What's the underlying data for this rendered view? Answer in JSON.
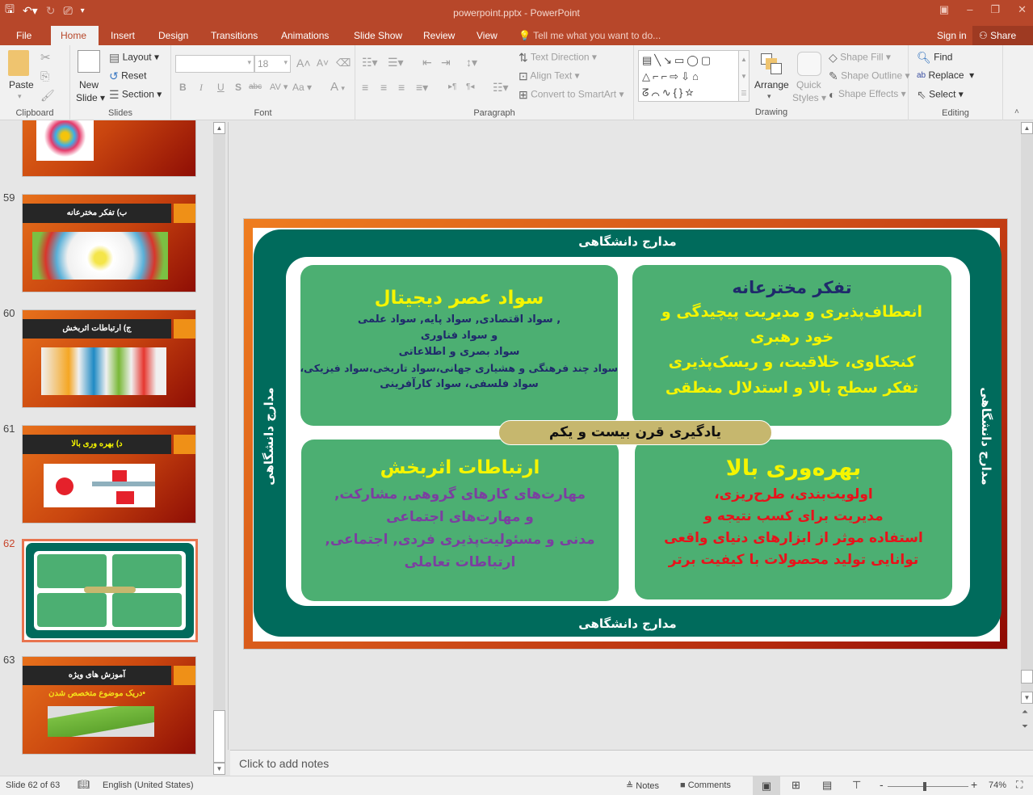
{
  "app": {
    "title": "powerpoint.pptx - PowerPoint",
    "qat": {
      "save_icon": "save-icon",
      "undo_icon": "undo-icon",
      "redo_icon": "redo-icon",
      "present_icon": "present-from-start-icon",
      "customize_icon": "customize-qat-icon"
    },
    "window_controls": {
      "ribbon_options": "▣",
      "minimize": "–",
      "restore": "❐",
      "close": "✕"
    }
  },
  "tabs": [
    {
      "label": "File"
    },
    {
      "label": "Home",
      "active": true
    },
    {
      "label": "Insert"
    },
    {
      "label": "Design"
    },
    {
      "label": "Transitions"
    },
    {
      "label": "Animations"
    },
    {
      "label": "Slide Show"
    },
    {
      "label": "Review"
    },
    {
      "label": "View"
    }
  ],
  "tell_me": "Tell me what you want to do...",
  "sign_in": "Sign in",
  "share": "Share",
  "ribbon": {
    "clipboard": {
      "label": "Clipboard",
      "paste": "Paste"
    },
    "slides": {
      "label": "Slides",
      "new_slide": "New",
      "new_slide_2": "Slide",
      "layout": "Layout",
      "reset": "Reset",
      "section": "Section"
    },
    "font": {
      "label": "Font",
      "font_name": "",
      "font_size": "18",
      "bold": "B",
      "italic": "I",
      "underline": "U",
      "shadow": "S",
      "strike": "abc",
      "spacing": "AV",
      "case": "Aa",
      "color": "A"
    },
    "paragraph": {
      "label": "Paragraph",
      "text_direction": "Text Direction",
      "align_text": "Align Text",
      "convert_smartart": "Convert to SmartArt"
    },
    "drawing": {
      "label": "Drawing",
      "shapes_row1": "▤╲↘▭◯▢",
      "shapes_row2": "△⌐⌐⇨⇩⌂",
      "shapes_row3": "ᘔ⌒∿{}☆",
      "arrange": "Arrange",
      "quick_styles_1": "Quick",
      "quick_styles_2": "Styles",
      "shape_fill": "Shape Fill",
      "shape_outline": "Shape Outline",
      "shape_effects": "Shape Effects"
    },
    "editing": {
      "label": "Editing",
      "find": "Find",
      "replace": "Replace",
      "select": "Select"
    }
  },
  "thumbnails": [
    {
      "number": "",
      "title": ""
    },
    {
      "number": "59",
      "title": "ب) تفکر مخترعانه"
    },
    {
      "number": "60",
      "title": "ج) ارتباطات اثربخش"
    },
    {
      "number": "61",
      "title": "د) بهره وری بالا"
    },
    {
      "number": "62",
      "title": "",
      "selected": true
    },
    {
      "number": "63",
      "title": "آموزش های ویژه",
      "subtitle": "•دریک موضوع متخصص شدن"
    }
  ],
  "slide": {
    "edge_top": "مدارج دانشگاهی",
    "edge_bottom": "مدارج دانشگاهی",
    "edge_left": "مدارج دانشگاهی",
    "edge_right": "مدارج دانشگاهی",
    "center_pill": "یادگیری قرن بیست و یکم",
    "cards": {
      "top_left": {
        "title": "سواد عصر دیجیتال",
        "lines": [
          ", سواد اقتصادی,  سواد پایه, سواد علمی",
          "و سواد فناوری",
          "سواد بصری و اطلاعاتی",
          "سواد چند فرهنگی و هشیاری جهانی،سواد تاریخی،سواد فیزیکی،",
          "سواد فلسفی، سواد کارآفرینی"
        ],
        "title_color": "#f5f500",
        "text_color": "#1f2a6b"
      },
      "top_right": {
        "title": "تفکر مخترعانه",
        "lines": [
          "انعطاف‌پذیری و مدیریت پیچیدگی و",
          "خود رهبری",
          "کنجکاوی، خلاقیت، و ریسک‌پذیری",
          "تفکر سطح بالا و استدلال منطقی"
        ],
        "title_color": "#1f2a6b",
        "text_color": "#f5f500"
      },
      "bottom_left": {
        "title": "ارتباطات اثربخش",
        "lines": [
          "مهارت‌های کارهای گروهی, مشارکت,",
          "و مهارت‌های اجتماعی",
          "مدنی و مسئولیت‌پذیری فردی, اجتماعی,",
          "ارتباطات تعاملی"
        ],
        "title_color": "#f5f500",
        "text_color": "#7b3fa0"
      },
      "bottom_right": {
        "title": "بهره‌وری بالا",
        "lines": [
          "اولویت‌بندی، طرح‌ریزی،",
          "مدیریت برای کسب نتیجه و",
          "استفاده موثر از ابزارهای دنیای واقعی",
          "توانایی تولید محصولات با کیفیت برتر"
        ],
        "title_color": "#f5f500",
        "text_color": "#e8121b"
      }
    },
    "colors": {
      "frame": "#006b5c",
      "card": "#4caf72",
      "pill": "#c6b76e"
    }
  },
  "notes_placeholder": "Click to add notes",
  "status": {
    "slide_info": "Slide 62 of 63",
    "language": "English (United States)",
    "notes": "Notes",
    "comments": "Comments",
    "zoom_minus": "-",
    "zoom_plus": "+",
    "zoom_level": "74%",
    "zoom_fraction": 0.46
  }
}
